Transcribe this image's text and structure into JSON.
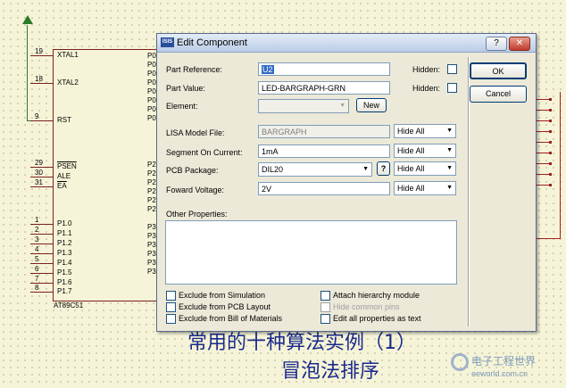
{
  "schematic": {
    "chip_name": "AT89C51",
    "left_pins": [
      {
        "num": "19",
        "label": "XTAL1"
      },
      {
        "num": "18",
        "label": "XTAL2"
      },
      {
        "num": "9",
        "label": "RST"
      },
      {
        "num": "29",
        "label": "PSEN"
      },
      {
        "num": "30",
        "label": "ALE"
      },
      {
        "num": "31",
        "label": "EA"
      },
      {
        "num": "1",
        "label": "P1.0"
      },
      {
        "num": "2",
        "label": "P1.1"
      },
      {
        "num": "3",
        "label": "P1.2"
      },
      {
        "num": "4",
        "label": "P1.3"
      },
      {
        "num": "5",
        "label": "P1.4"
      },
      {
        "num": "6",
        "label": "P1.5"
      },
      {
        "num": "7",
        "label": "P1.6"
      },
      {
        "num": "8",
        "label": "P1.7"
      }
    ],
    "right_fragments": [
      "P0",
      "P0",
      "P0",
      "P0",
      "P0",
      "P0",
      "P0",
      "P0",
      "P2",
      "P2",
      "P2",
      "P2",
      "P2",
      "P2",
      "P3",
      "P3",
      "P3",
      "P3",
      "P3",
      "P3"
    ],
    "overlay_line1": "常用的十种算法实例（1）",
    "overlay_line2": "冒泡法排序",
    "watermark": "电子工程世界",
    "watermark_url": "eeworld.com.cn"
  },
  "dialog": {
    "title": "Edit Component",
    "app_icon": "ISIS",
    "help_btn": "?",
    "close_btn": "✕",
    "part_reference_label": "Part Reference:",
    "part_reference_value": "U2",
    "part_value_label": "Part Value:",
    "part_value_value": "LED-BARGRAPH-GRN",
    "element_label": "Element:",
    "element_value": "",
    "new_button": "New",
    "hidden_label_1": "Hidden:",
    "hidden_label_2": "Hidden:",
    "ok_button": "OK",
    "cancel_button": "Cancel",
    "lisa_label": "LISA Model File:",
    "lisa_value": "BARGRAPH",
    "segment_label": "Segment On Current:",
    "segment_value": "1mA",
    "pcb_label": "PCB Package:",
    "pcb_value": "DIL20",
    "pcb_help": "?",
    "voltage_label": "Foward Voltage:",
    "voltage_value": "2V",
    "hide_all_1": "Hide All",
    "hide_all_2": "Hide All",
    "hide_all_3": "Hide All",
    "hide_all_4": "Hide All",
    "other_props_label": "Other Properties:",
    "other_props_value": "",
    "checkboxes": {
      "excl_sim": "Exclude from Simulation",
      "excl_pcb": "Exclude from PCB Layout",
      "excl_bom": "Exclude from Bill of Materials",
      "attach_hier": "Attach hierarchy module",
      "hide_common": "Hide common pins",
      "edit_all": "Edit all properties as text"
    }
  },
  "colors": {
    "accent": "#2a4f9a",
    "canvas": "#f6f4d8",
    "dialog": "#ece9d8",
    "wire_green": "#2a7a2a",
    "wire_red": "#a02020"
  }
}
